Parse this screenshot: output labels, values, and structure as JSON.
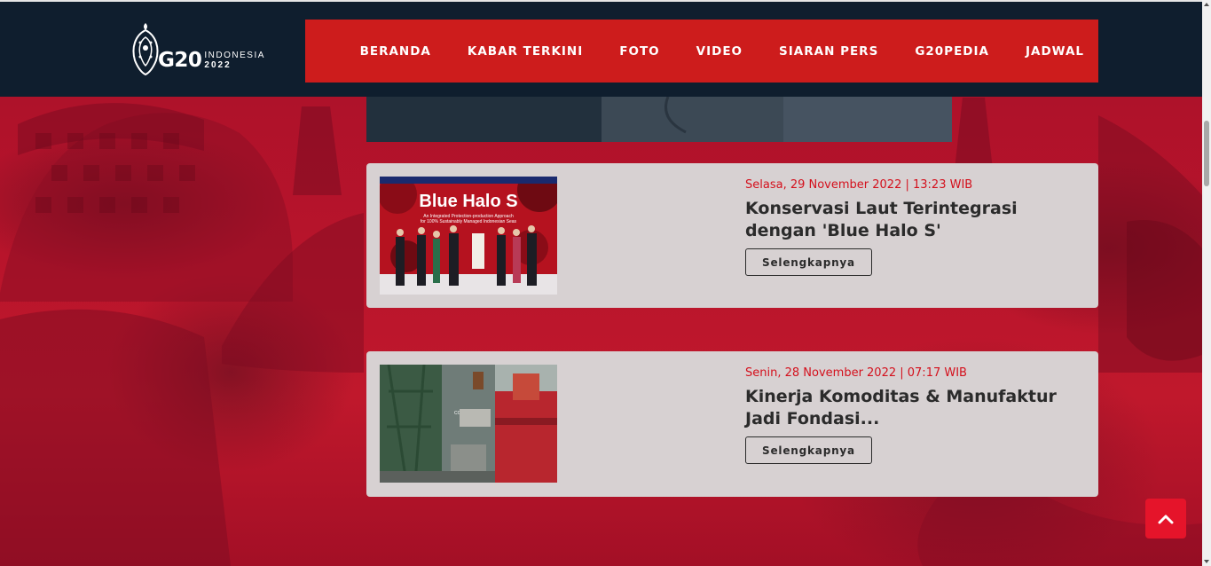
{
  "header": {
    "logo": {
      "brand": "G20",
      "country": "INDONESIA",
      "year": "2022"
    },
    "nav": [
      {
        "label": "BERANDA"
      },
      {
        "label": "KABAR TERKINI"
      },
      {
        "label": "FOTO"
      },
      {
        "label": "VIDEO"
      },
      {
        "label": "SIARAN PERS"
      },
      {
        "label": "G20PEDIA"
      },
      {
        "label": "JADWAL"
      }
    ]
  },
  "news": [
    {
      "date": "Selasa, 29 November 2022 | 13:23 WIB",
      "title": "Konservasi Laut Terintegrasi dengan 'Blue Halo S'",
      "button": "Selengkapnya",
      "thumb": {
        "headline": "Blue Halo S",
        "subline1": "An Integrated Protection-production Approach",
        "subline2": "for 100% Sustainably Managed Indonesian Seas"
      }
    },
    {
      "date": "Senin, 28 November 2022 | 07:17 WIB",
      "title": "Kinerja Komoditas & Manufaktur Jadi Fondasi...",
      "button": "Selengkapnya",
      "thumb": {
        "container_text": "CC 05-1"
      }
    }
  ],
  "colors": {
    "header_bg": "#0f1e2e",
    "nav_bg": "#cd1c1c",
    "card_bg": "#d7d1d2",
    "date_red": "#d4101c",
    "back_to_top": "#e5142a"
  },
  "icons": {
    "back_to_top": "chevron-up-icon",
    "logo": "g20-batik-mark"
  }
}
